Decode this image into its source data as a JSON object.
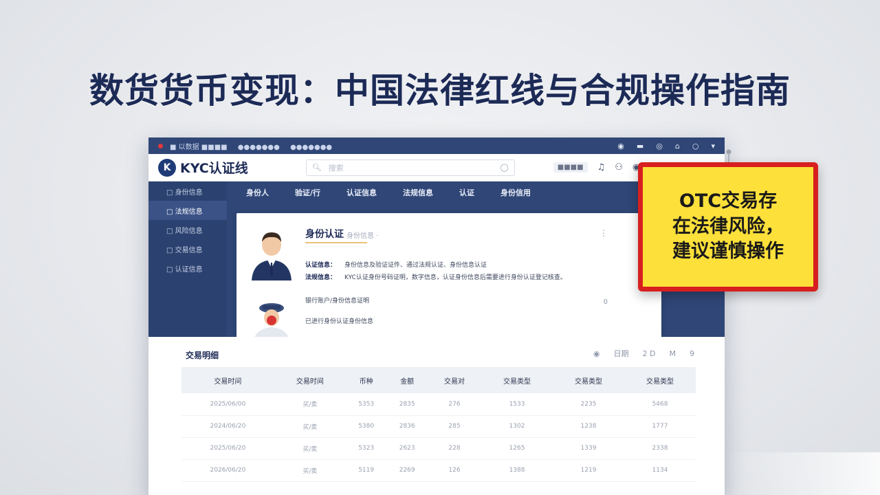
{
  "headline": "数货货币变现：中国法律红线与合规操作指南",
  "window": {
    "topbar": {
      "menu": [
        "■ 以数据 ■■■■",
        "●●●●●●●",
        "●●●●●●●"
      ],
      "icons": [
        "settings-icon",
        "card-icon",
        "record-icon",
        "lock-icon",
        "shield-icon",
        "chevron-icon"
      ]
    },
    "appbar": {
      "logo_mark": "K",
      "logo_text": "KYC认证线",
      "search_placeholder": "搜索",
      "chip": "■■■■",
      "icons": [
        "bell-icon",
        "user-icon",
        "help-icon"
      ]
    },
    "sidebar": {
      "items": [
        "□ 身份信息",
        "□ 法规信息",
        "□ 风险信息",
        "□ 交易信息",
        "□ 认证信息"
      ]
    },
    "tabs": [
      "身份人",
      "验证/行",
      "认证信息",
      "法规信息",
      "认证",
      "身份信用"
    ],
    "profile": {
      "title": "身份认证",
      "subtitle": "身份信息 ·",
      "row1_label": "认证信息：",
      "row1_value": "身份信息及验证证件、通过法规认证、身份信息认证",
      "row2_label": "法规信息：",
      "row2_value": "KYC认证身份号码证明，数字信息，认证身份信息后需要进行身份认证登记核查。",
      "row3": "银行账户/身份信息证明",
      "row4": "已进行身份认证身份信息",
      "more": "⋮",
      "zero": "0"
    },
    "transactions": {
      "title": "交易明细",
      "tools": [
        "◉",
        "日期",
        "2 D",
        "M",
        "9"
      ],
      "headers": [
        "交易时间",
        "交易时间",
        "币种",
        "金额",
        "交易对",
        "交易类型",
        "交易类型",
        "交易类型"
      ],
      "rows": [
        [
          "2025/06/00",
          "买/卖",
          "5353",
          "2835",
          "276",
          "1533",
          "2235",
          "5468"
        ],
        [
          "2024/06/20",
          "买/卖",
          "5380",
          "2836",
          "285",
          "1302",
          "1238",
          "1777"
        ],
        [
          "2025/06/20",
          "买/卖",
          "5323",
          "2623",
          "228",
          "1265",
          "1339",
          "2338"
        ],
        [
          "2026/06/20",
          "买/卖",
          "5119",
          "2269",
          "126",
          "1388",
          "1219",
          "1134"
        ]
      ]
    }
  },
  "notice": {
    "line1": "OTC交易存",
    "line2": "在法律风险，",
    "line3": "建议谨慎操作"
  },
  "colors": {
    "navy": "#2f4676",
    "sidebar": "#2b416f",
    "notice_bg": "#fde03a",
    "notice_border": "#d81f1f",
    "title": "#1c2a56"
  }
}
